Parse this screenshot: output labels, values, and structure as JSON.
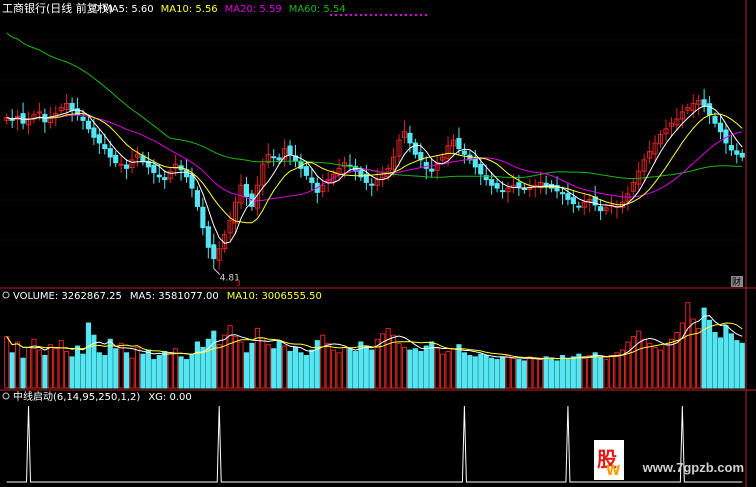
{
  "colors": {
    "bg": "#000000",
    "grid": "#5a0000",
    "separator": "#b32424",
    "up": "#e02424",
    "down": "#54e6f2",
    "ma5": "#ffffff",
    "ma10": "#ffff33",
    "ma20": "#e000e0",
    "ma60": "#18b818",
    "price_low_label": "#d0d0d0",
    "xg_line": "#ffffff"
  },
  "price_panel": {
    "title": "工商银行(日线 前复权)",
    "legend": [
      {
        "name": "MA5",
        "value": "5.60",
        "color": "#ffffff"
      },
      {
        "name": "MA10",
        "value": "5.56",
        "color": "#ffff33"
      },
      {
        "name": "MA20",
        "value": "5.59",
        "color": "#e000e0"
      },
      {
        "name": "MA60",
        "value": "5.54",
        "color": "#18b818"
      }
    ],
    "low_label": "4.81",
    "marker_3": "3",
    "marker_cai": "财"
  },
  "volume_panel": {
    "legend": [
      {
        "name": "VOLUME",
        "value": "3262867.25",
        "color": "#ffffff"
      },
      {
        "name": "MA5",
        "value": "3581077.00",
        "color": "#ffffff"
      },
      {
        "name": "MA10",
        "value": "3006555.50",
        "color": "#ffff33"
      }
    ]
  },
  "indicator_panel": {
    "legend": [
      {
        "name": "中线启动(6,14,95,250,1,2)",
        "value": "",
        "color": "#ffffff"
      },
      {
        "name": "XG",
        "value": "0.00",
        "color": "#ffffff"
      }
    ]
  },
  "watermark": {
    "site": "www.7gpzb.com",
    "glyph": "股",
    "glyph2": "W"
  },
  "chart_data": [
    {
      "type": "candlestick",
      "title": "工商银行(日线 前复权)",
      "ylim": [
        4.7,
        6.6
      ],
      "min_labeled_low": 4.81,
      "last_values": {
        "MA5": 5.6,
        "MA10": 5.56,
        "MA20": 5.59,
        "MA60": 5.54
      },
      "close": [
        5.88,
        5.86,
        5.89,
        5.84,
        5.87,
        5.9,
        5.92,
        5.85,
        5.88,
        5.91,
        5.95,
        5.98,
        5.93,
        5.9,
        5.86,
        5.8,
        5.74,
        5.7,
        5.66,
        5.6,
        5.56,
        5.55,
        5.52,
        5.58,
        5.62,
        5.57,
        5.53,
        5.49,
        5.46,
        5.44,
        5.5,
        5.55,
        5.51,
        5.46,
        5.38,
        5.25,
        5.1,
        4.96,
        4.88,
        4.95,
        5.05,
        5.15,
        5.28,
        5.4,
        5.32,
        5.25,
        5.4,
        5.55,
        5.62,
        5.6,
        5.58,
        5.66,
        5.62,
        5.57,
        5.52,
        5.47,
        5.42,
        5.35,
        5.4,
        5.44,
        5.48,
        5.52,
        5.56,
        5.54,
        5.5,
        5.46,
        5.42,
        5.4,
        5.44,
        5.48,
        5.52,
        5.6,
        5.72,
        5.78,
        5.7,
        5.62,
        5.58,
        5.52,
        5.5,
        5.56,
        5.6,
        5.68,
        5.72,
        5.66,
        5.62,
        5.58,
        5.53,
        5.48,
        5.44,
        5.4,
        5.38,
        5.36,
        5.38,
        5.4,
        5.39,
        5.37,
        5.38,
        5.4,
        5.42,
        5.4,
        5.38,
        5.36,
        5.34,
        5.3,
        5.27,
        5.25,
        5.28,
        5.3,
        5.26,
        5.22,
        5.24,
        5.26,
        5.25,
        5.28,
        5.34,
        5.42,
        5.5,
        5.58,
        5.64,
        5.7,
        5.76,
        5.8,
        5.84,
        5.87,
        5.92,
        5.95,
        5.98,
        6.0,
        5.96,
        5.9,
        5.84,
        5.78,
        5.7,
        5.65,
        5.62,
        5.6
      ]
    },
    {
      "type": "bar",
      "title": "VOLUME",
      "last_values": {
        "VOLUME": 3262867.25,
        "MA5": 3581077.0,
        "MA10": 3006555.5
      },
      "values": [
        3.8,
        2.6,
        3.4,
        2.2,
        3.0,
        3.6,
        2.8,
        2.4,
        3.2,
        2.9,
        3.5,
        2.7,
        2.3,
        3.1,
        2.5,
        4.8,
        3.9,
        2.6,
        2.4,
        3.6,
        2.9,
        3.3,
        2.6,
        2.2,
        3.0,
        2.5,
        2.8,
        2.1,
        2.4,
        2.7,
        2.6,
        2.9,
        2.3,
        2.1,
        2.5,
        3.4,
        3.0,
        3.6,
        4.2,
        3.2,
        3.9,
        4.6,
        3.8,
        3.4,
        2.6,
        3.3,
        4.4,
        3.7,
        3.2,
        2.9,
        3.5,
        3.1,
        2.7,
        3.0,
        2.6,
        2.4,
        2.8,
        3.5,
        3.9,
        3.3,
        2.8,
        2.6,
        3.0,
        2.9,
        2.7,
        3.4,
        3.1,
        2.8,
        3.6,
        4.0,
        4.4,
        3.9,
        3.3,
        3.0,
        2.8,
        2.9,
        2.7,
        3.1,
        3.4,
        2.9,
        2.5,
        2.7,
        2.9,
        3.2,
        2.6,
        2.4,
        2.3,
        2.5,
        2.4,
        2.2,
        2.1,
        2.3,
        2.4,
        2.2,
        2.1,
        2.0,
        2.3,
        2.2,
        2.1,
        2.3,
        2.2,
        2.0,
        2.4,
        2.1,
        2.3,
        2.5,
        2.2,
        2.4,
        2.6,
        2.3,
        2.1,
        2.4,
        2.6,
        2.8,
        3.4,
        3.8,
        4.2,
        3.6,
        3.3,
        3.0,
        2.8,
        3.2,
        3.6,
        4.1,
        4.8,
        6.3,
        5.1,
        4.4,
        5.9,
        5.0,
        4.1,
        3.7,
        4.6,
        4.0,
        3.5,
        3.3
      ]
    },
    {
      "type": "line",
      "title": "中线启动(6,14,95,250,1,2)",
      "series": [
        {
          "name": "XG",
          "last_value": 0.0
        }
      ],
      "signal_bars": [
        4,
        39,
        84,
        103,
        124
      ]
    }
  ]
}
